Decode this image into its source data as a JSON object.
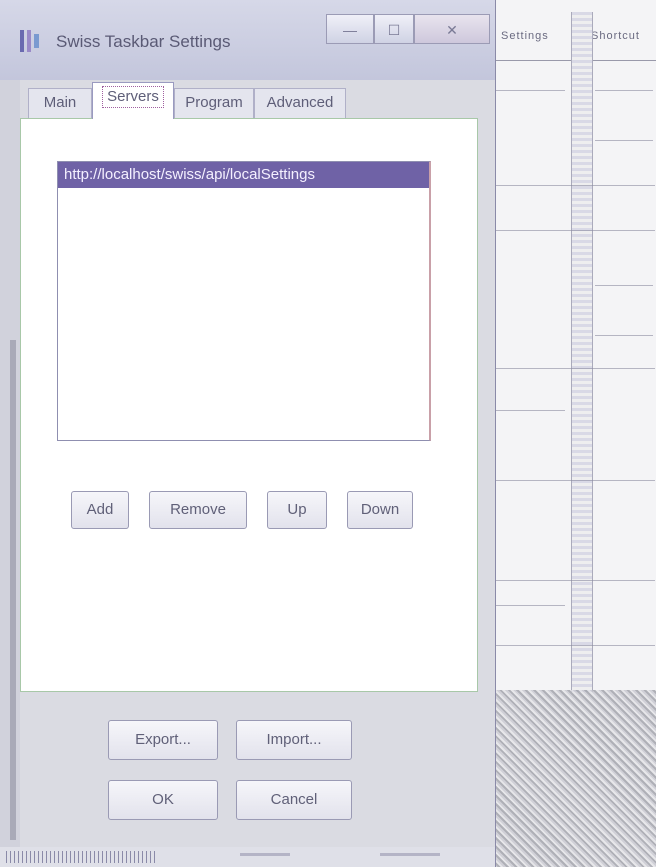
{
  "window": {
    "title": "Swiss Taskbar Settings",
    "controls": {
      "minimize": "—",
      "maximize": "☐",
      "close": "✕"
    }
  },
  "tabs": [
    {
      "label": "Main",
      "active": false
    },
    {
      "label": "Servers",
      "active": true
    },
    {
      "label": "Program",
      "active": false
    },
    {
      "label": "Advanced",
      "active": false
    }
  ],
  "servers": {
    "items": [
      "http://localhost/swiss/api/localSettings"
    ]
  },
  "server_buttons": {
    "add": "Add",
    "remove": "Remove",
    "up": "Up",
    "down": "Down"
  },
  "footer_buttons": {
    "export": "Export...",
    "import": "Import...",
    "ok": "OK",
    "cancel": "Cancel"
  },
  "background_app": {
    "tab1": "Settings",
    "tab2": "Shortcut"
  },
  "colors": {
    "selection": "#6f62a6",
    "titlebar": "#c3c6dc",
    "dialog_bg": "#dadbe2"
  }
}
